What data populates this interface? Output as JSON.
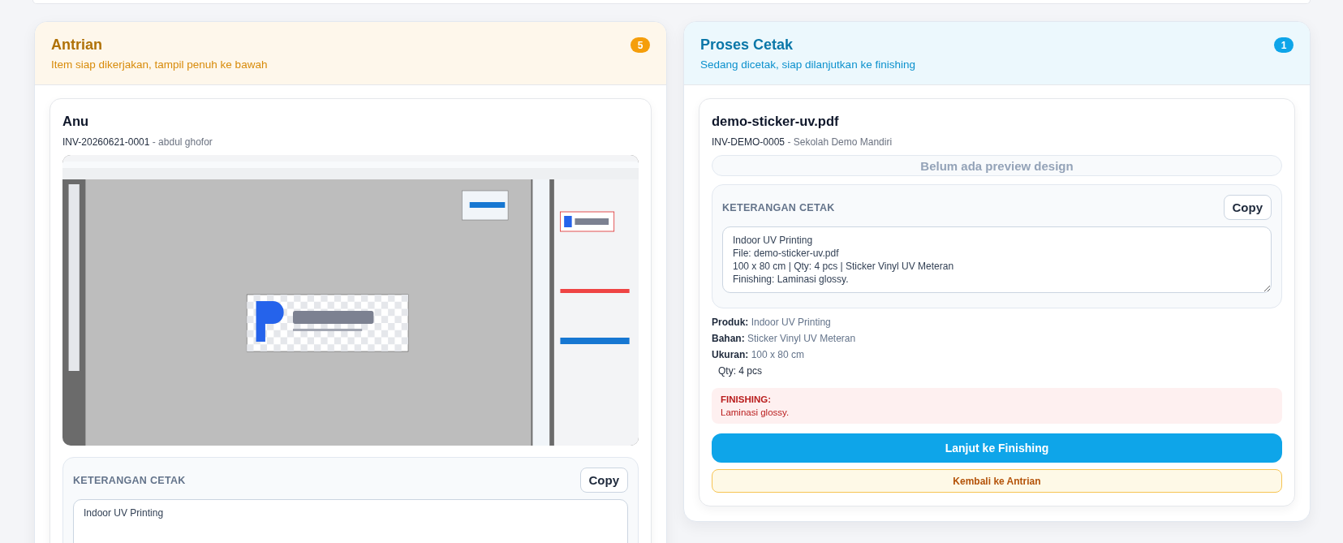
{
  "columns": [
    {
      "title": "Antrian",
      "subtitle": "Item siap dikerjakan, tampil penuh ke bawah",
      "count": "5",
      "color": "#f59e0b",
      "cards": [
        {
          "title": "Anu",
          "invoice": "INV-20260621-0001",
          "separator": "-",
          "customer": "abdul ghofor",
          "preview": {
            "kind": "image"
          },
          "note": {
            "label": "KETERANGAN CETAK",
            "copy_label": "Copy",
            "text": "Indoor UV Printing"
          }
        }
      ]
    },
    {
      "title": "Proses Cetak",
      "subtitle": "Sedang dicetak, siap dilanjutkan ke finishing",
      "count": "1",
      "color": "#0ea5e9",
      "cards": [
        {
          "title": "demo-sticker-uv.pdf",
          "invoice": "INV-DEMO-0005",
          "separator": "-",
          "customer": "Sekolah Demo Mandiri",
          "preview": {
            "kind": "empty",
            "text": "Belum ada preview design"
          },
          "note": {
            "label": "KETERANGAN CETAK",
            "copy_label": "Copy",
            "text": "Indoor UV Printing\nFile: demo-sticker-uv.pdf\n100 x 80 cm | Qty: 4 pcs | Sticker Vinyl UV Meteran\nFinishing: Laminasi glossy."
          },
          "details": [
            "**Produk:** Indoor UV Printing",
            "**Bahan:** Sticker Vinyl UV Meteran",
            "**Ukuran:** 100 x 80 cm"
          ],
          "qty": "Qty: 4 pcs",
          "finishing": {
            "label": "FINISHING:",
            "text": "Laminasi glossy."
          },
          "actions": [
            {
              "label": "Lanjut ke Finishing",
              "kind": "primary"
            },
            {
              "label": "Kembali ke Antrian",
              "kind": "secondary"
            }
          ]
        }
      ]
    }
  ]
}
